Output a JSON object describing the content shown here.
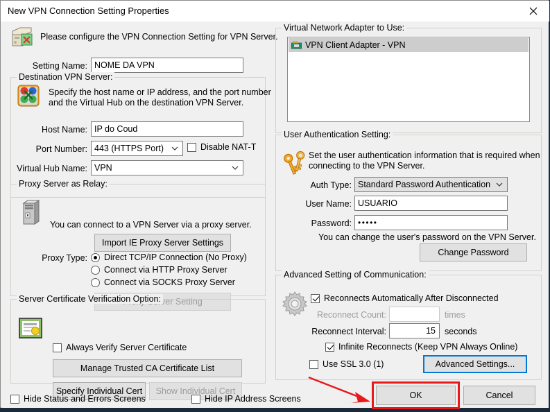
{
  "window": {
    "title": "New VPN Connection Setting Properties",
    "close_icon": "close-icon"
  },
  "header": {
    "icon": "vpn-server-icon",
    "description": "Please configure the VPN Connection Setting for VPN Server."
  },
  "setting_name": {
    "label": "Setting Name:",
    "value": "NOME DA VPN"
  },
  "destination": {
    "group_label": "Destination VPN Server:",
    "icon": "hub-connection-icon",
    "description_line1": "Specify the host name or IP address, and the port number",
    "description_line2": "and the Virtual Hub on the destination VPN Server.",
    "host_name_label": "Host Name:",
    "host_name_value": "IP do Coud",
    "port_number_label": "Port Number:",
    "port_number_value": "443 (HTTPS Port)",
    "disable_natt_label": "Disable NAT-T",
    "disable_natt_checked": false,
    "virtual_hub_label": "Virtual Hub Name:",
    "virtual_hub_value": "VPN"
  },
  "proxy": {
    "group_label": "Proxy Server as Relay:",
    "icon": "computer-tower-icon",
    "description": "You can connect to a VPN Server via a proxy server.",
    "import_button": "Import IE Proxy Server Settings",
    "proxy_type_label": "Proxy Type:",
    "options": [
      {
        "label": "Direct TCP/IP Connection (No Proxy)",
        "selected": true
      },
      {
        "label": "Connect via HTTP Proxy Server",
        "selected": false
      },
      {
        "label": "Connect via SOCKS Proxy Server",
        "selected": false
      }
    ],
    "proxy_setting_button": "Proxy Server Setting",
    "proxy_setting_disabled": true
  },
  "server_cert": {
    "group_label": "Server Certificate Verification Option:",
    "icon": "certificate-icon",
    "always_verify_label": "Always Verify Server Certificate",
    "always_verify_checked": false,
    "manage_ca_button": "Manage Trusted CA Certificate List",
    "specify_cert_button": "Specify Individual Cert",
    "show_cert_button": "Show Individual Cert",
    "show_cert_disabled": true
  },
  "virtual_adapter": {
    "group_label": "Virtual Network Adapter to Use:",
    "items": [
      {
        "label": "VPN Client Adapter - VPN",
        "icon": "network-adapter-icon",
        "selected": true
      }
    ]
  },
  "user_auth": {
    "group_label": "User Authentication Setting:",
    "icon": "keys-icon",
    "description_line1": "Set the user authentication information that is required when",
    "description_line2": "connecting to the VPN Server.",
    "auth_type_label": "Auth Type:",
    "auth_type_value": "Standard Password Authentication",
    "user_name_label": "User Name:",
    "user_name_value": "USUARIO",
    "password_label": "Password:",
    "password_value": "•••••",
    "password_note": "You can change the user's password on the VPN Server.",
    "change_password_button": "Change Password"
  },
  "advanced": {
    "group_label": "Advanced Setting of Communication:",
    "icon": "gear-icon",
    "reconnect_auto_label": "Reconnects Automatically After Disconnected",
    "reconnect_auto_checked": true,
    "reconnect_count_label": "Reconnect Count:",
    "reconnect_count_value": "",
    "reconnect_count_unit": "times",
    "reconnect_interval_label": "Reconnect Interval:",
    "reconnect_interval_value": "15",
    "reconnect_interval_unit": "seconds",
    "infinite_reconnects_label": "Infinite Reconnects (Keep VPN Always Online)",
    "infinite_reconnects_checked": true,
    "use_ssl3_label": "Use SSL 3.0 (1)",
    "use_ssl3_checked": false,
    "advanced_settings_button": "Advanced Settings..."
  },
  "footer": {
    "hide_status_label": "Hide Status and Errors Screens",
    "hide_status_checked": false,
    "hide_ip_label": "Hide IP Address Screens",
    "hide_ip_checked": false,
    "ok_button": "OK",
    "cancel_button": "Cancel"
  },
  "annotation": {
    "highlight_color": "#e8191b",
    "target": "ok-button"
  }
}
